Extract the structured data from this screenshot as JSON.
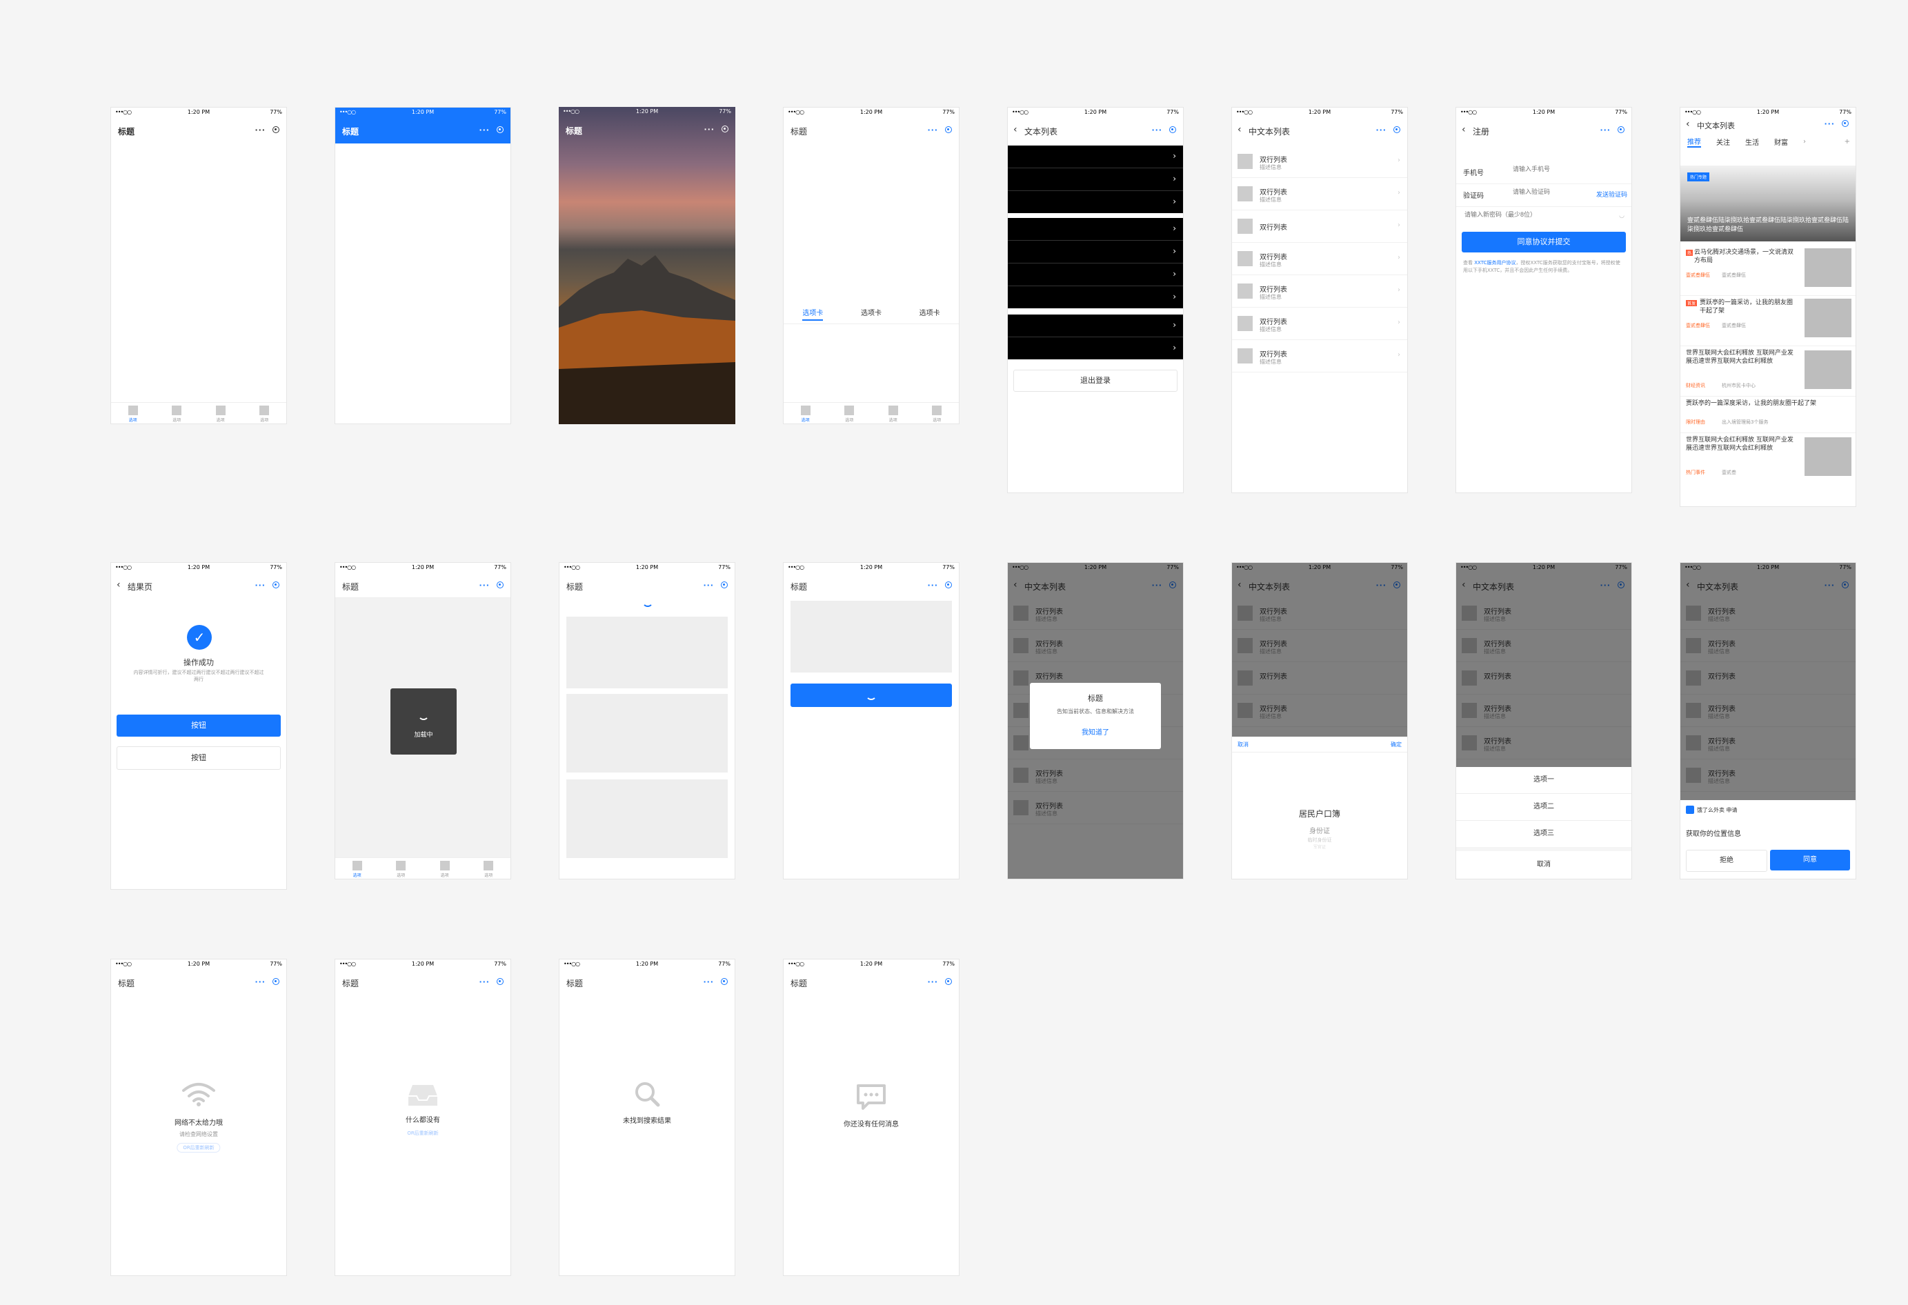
{
  "status": {
    "signal": "•••○○",
    "time": "1:20 PM",
    "battery": "77%"
  },
  "common": {
    "title": "标题",
    "more_icon": "more-icon",
    "target_icon": "target-icon",
    "chev": "›",
    "back": "‹",
    "tab": "选项"
  },
  "tabs_page": {
    "items": [
      "选项卡",
      "选项卡",
      "选项卡"
    ]
  },
  "text_list": {
    "title": "文本列表",
    "logout": "退出登录"
  },
  "cn_list": {
    "title": "中文本列表",
    "item_title": "双行列表",
    "item_desc": "描述信息",
    "item_single": "双行列表"
  },
  "register": {
    "title": "注册",
    "phone_label": "手机号",
    "phone_ph": "请输入手机号",
    "code_label": "验证码",
    "code_ph": "请输入验证码",
    "code_btn": "发送验证码",
    "pwd_ph": "请输入新密码（最少8位）",
    "submit": "同意协议并提交",
    "agreement_a": "查看",
    "agreement_b": "XXTC服务用户协议",
    "agreement_c": "，授权XXTC服务获取您的支付宝账号，将授权使用以下",
    "agreement_d": "手机XXTC，并且不会因此产生任何手续费。"
  },
  "news": {
    "title": "中文本列表",
    "tabs": [
      "推荐",
      "关注",
      "生活",
      "财富"
    ],
    "tab_more": "›",
    "tab_add": "+",
    "banner_tag": "热门专题",
    "banner_text": "壹贰叁肆伍陆柒捌玖拾壹贰叁肆伍陆柒捌玖拾壹贰叁肆伍陆柒捌玖拾壹贰叁肆伍",
    "items": [
      {
        "badge": "热",
        "text": "云马化腾对决交通场景，一文说清双方布局",
        "meta1": "壹贰叁肆伍",
        "meta2": "壹贰叁肆伍"
      },
      {
        "badge": "首发",
        "text": "贾跃亭的一篇采访，让我的朋友圈干起了架",
        "meta1": "壹贰叁肆伍",
        "meta2": "壹贰叁肆伍"
      },
      {
        "badge": "",
        "text": "世界互联网大会红利释放 互联网产业发展迅速世界互联网大会红利释放",
        "meta1": "财经资讯",
        "meta2": "杭州市民卡中心"
      },
      {
        "badge": "",
        "text": "贾跃亭的一篇深度采访，让我的朋友圈干起了架",
        "meta1": "限时理由",
        "meta2": "出入境管理局3个服务"
      },
      {
        "badge": "",
        "text": "世界互联网大会红利释放 互联网产业发展迅速世界互联网大会红利释放",
        "meta1": "热门事件",
        "meta2": "壹贰叁"
      }
    ]
  },
  "result": {
    "title": "结果页",
    "success": "操作成功",
    "desc": "内容详情可折行，建议不超过两行建议不超过两行建议不超过两行",
    "btn1": "按钮",
    "btn2": "按钮"
  },
  "loading": {
    "text": "加载中"
  },
  "dialog": {
    "title": "标题",
    "content": "告知当前状态、信息和解决方法",
    "action": "我知道了"
  },
  "picker": {
    "cancel": "取消",
    "confirm": "确定",
    "options": [
      "居民户口簿",
      "身份证",
      "临时身份证",
      "军官证"
    ]
  },
  "action_sheet": {
    "options": [
      "选项一",
      "选项二",
      "选项三"
    ],
    "cancel": "取消"
  },
  "auth": {
    "app": "饿了么外卖 申请",
    "content": "获取你的位置信息",
    "reject": "拒绝",
    "agree": "同意"
  },
  "empty_network": {
    "text": "网络不太给力哦",
    "sub": "请检查网络设置",
    "btn": "OR后重新刷新"
  },
  "empty_nothing": {
    "text": "什么都没有",
    "btn": "OR后重新刷新"
  },
  "empty_search": {
    "text": "未找到搜索结果"
  },
  "empty_msg": {
    "text": "你还没有任何消息"
  },
  "colors": {
    "accent": "#1677ff",
    "bg": "#f5f5f5"
  }
}
